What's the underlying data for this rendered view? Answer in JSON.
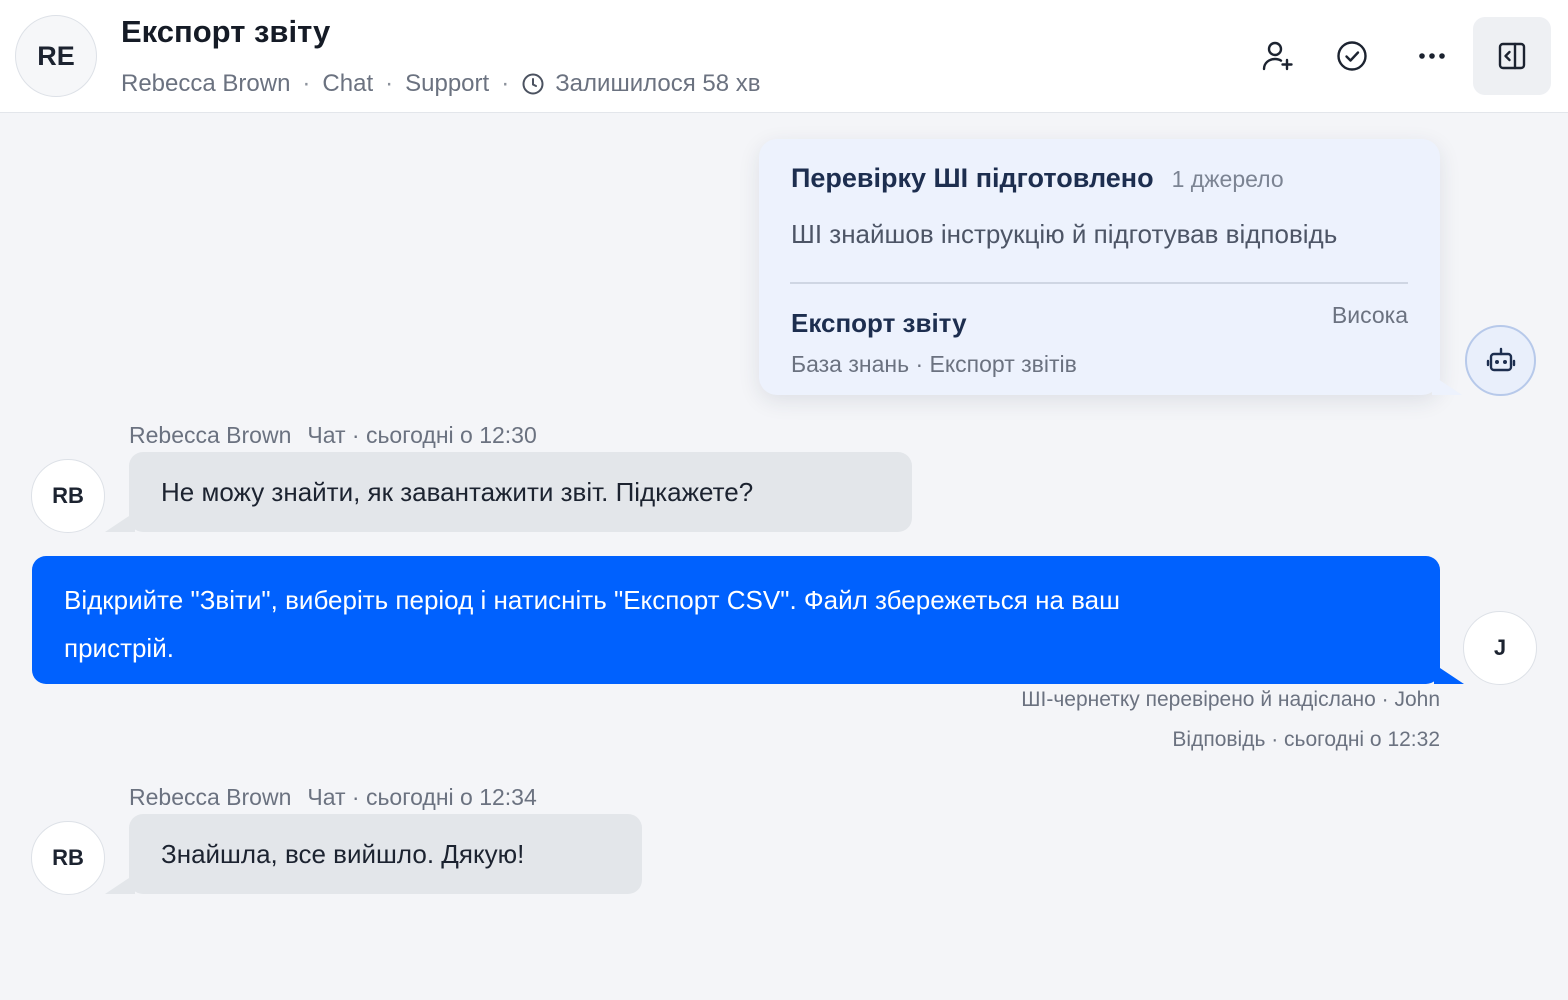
{
  "header": {
    "avatar_initials": "RE",
    "title": "Експорт звіту",
    "customer": "Rebecca Brown",
    "channel": "Chat",
    "team": "Support",
    "sla": "Залишилося 58 хв",
    "buttons": {
      "assign": "user-plus-icon",
      "resolve": "check-circle-icon",
      "more": "more-icon",
      "panel": "sidebar-toggle-icon"
    }
  },
  "ai_review": {
    "title": "Перевірку ШІ підготовлено",
    "sources": "1 джерело",
    "summary": "ШІ знайшов інструкцію й підготував відповідь",
    "source_title": "Експорт звіту",
    "source_path": "База знань · Експорт звітів",
    "priority": "Висока",
    "avatar_icon": "robot-icon"
  },
  "messages": [
    {
      "author": "Rebecca Brown",
      "meta": "Чат · сьогодні о 12:30",
      "initials": "RB",
      "text": "Не можу знайти, як завантажити звіт. Підкажете?"
    },
    {
      "initials": "J",
      "text": "Відкрийте \"Звіти\", виберіть період і натисніть \"Експорт CSV\". Файл збережеться на ваш пристрій.",
      "status": "ШІ-чернетку перевірено й надіслано · John",
      "meta": "Відповідь · сьогодні о 12:32"
    },
    {
      "author": "Rebecca Brown",
      "meta": "Чат · сьогодні о 12:34",
      "initials": "RB",
      "text": "Знайшла, все вийшло. Дякую!"
    }
  ],
  "colors": {
    "accent": "#0061fe",
    "background": "#f4f5f8",
    "ai_card": "#edf2fd",
    "incoming_bubble": "#e3e6ea"
  }
}
